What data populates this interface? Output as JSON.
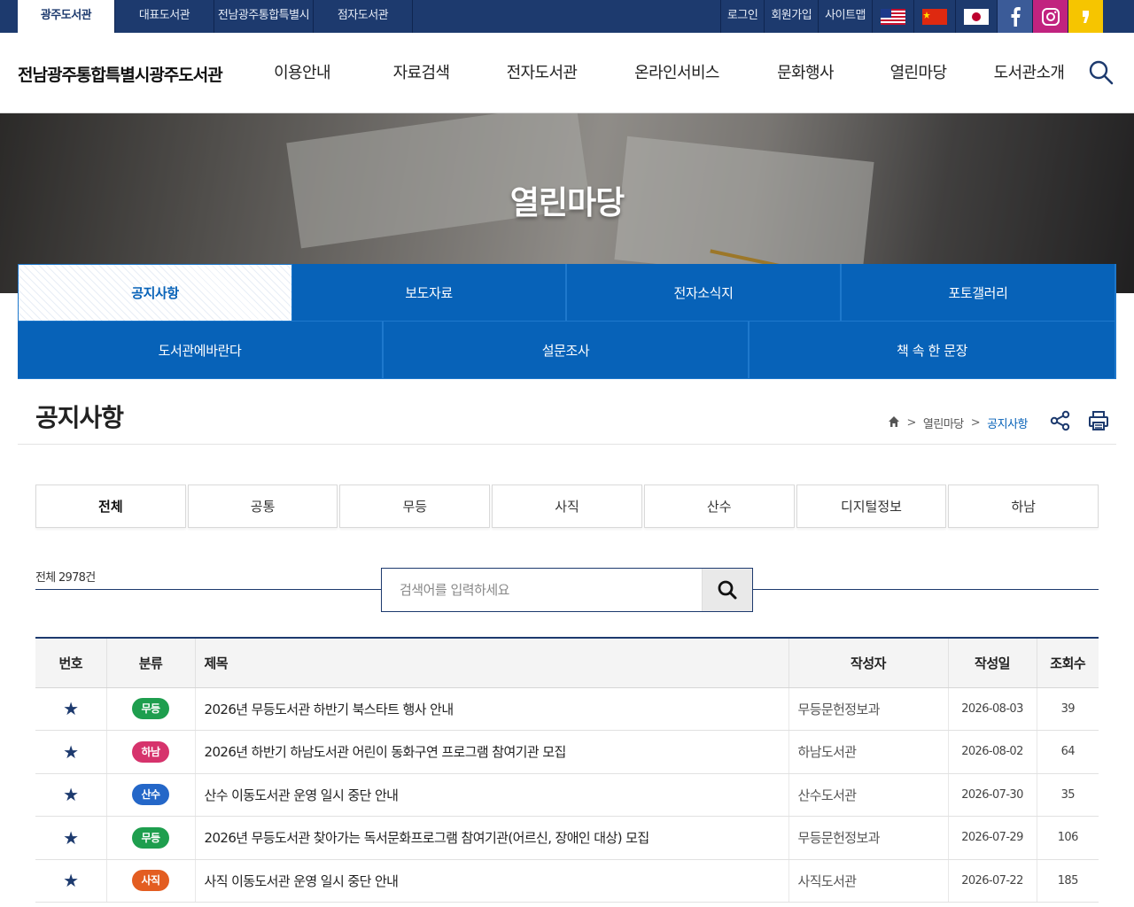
{
  "topbar": {
    "sites": [
      {
        "label": "광주도서관",
        "active": true
      },
      {
        "label": "대표도서관",
        "active": false
      },
      {
        "label": "전남광주통합특별시",
        "active": false
      },
      {
        "label": "점자도서관",
        "active": false
      }
    ],
    "util": [
      "로그인",
      "회원가입",
      "사이트맵"
    ],
    "flags": [
      "us-flag-icon",
      "china-flag-icon",
      "japan-flag-icon"
    ],
    "sns": [
      "facebook-icon",
      "instagram-icon",
      "kakaostory-icon"
    ]
  },
  "header": {
    "logo": "전남광주통합특별시광주도서관",
    "gnb": [
      "이용안내",
      "자료검색",
      "전자도서관",
      "온라인서비스",
      "문화행사",
      "열린마당",
      "도서관소개"
    ]
  },
  "visual": {
    "title": "열린마당"
  },
  "submenu": {
    "row1": [
      "공지사항",
      "보도자료",
      "전자소식지",
      "포토갤러리"
    ],
    "row2": [
      "도서관에바란다",
      "설문조사",
      "책 속 한 문장"
    ],
    "active": "공지사항"
  },
  "page": {
    "title": "공지사항",
    "breadcrumb": [
      "열린마당",
      "공지사항"
    ]
  },
  "categories": [
    "전체",
    "공통",
    "무등",
    "사직",
    "산수",
    "디지털정보",
    "하남"
  ],
  "count_text": "전체 2978건",
  "search": {
    "placeholder": "검색어를 입력하세요"
  },
  "table": {
    "headers": [
      "번호",
      "분류",
      "제목",
      "작성자",
      "작성일",
      "조회수"
    ],
    "rows": [
      {
        "no": "★",
        "cat": "무등",
        "cat_color": "#1e9e4e",
        "title": "2026년 무등도서관 하반기 북스타트 행사 안내",
        "writer": "무등문헌정보과",
        "date": "2026-08-03",
        "views": "39"
      },
      {
        "no": "★",
        "cat": "하남",
        "cat_color": "#d6336c",
        "title": "2026년 하반기 하남도서관 어린이 동화구연 프로그램 참여기관 모집",
        "writer": "하남도서관",
        "date": "2026-08-02",
        "views": "64"
      },
      {
        "no": "★",
        "cat": "산수",
        "cat_color": "#2467c8",
        "title": "산수 이동도서관 운영 일시 중단 안내",
        "writer": "산수도서관",
        "date": "2026-07-30",
        "views": "35"
      },
      {
        "no": "★",
        "cat": "무등",
        "cat_color": "#1e9e4e",
        "title": "2026년 무등도서관 찾아가는 독서문화프로그램 참여기관(어르신, 장애인 대상) 모집",
        "writer": "무등문헌정보과",
        "date": "2026-07-29",
        "views": "106"
      },
      {
        "no": "★",
        "cat": "사직",
        "cat_color": "#e35d21",
        "title": "사직 이동도서관 운영 일시 중단 안내",
        "writer": "사직도서관",
        "date": "2026-07-22",
        "views": "185"
      }
    ]
  }
}
